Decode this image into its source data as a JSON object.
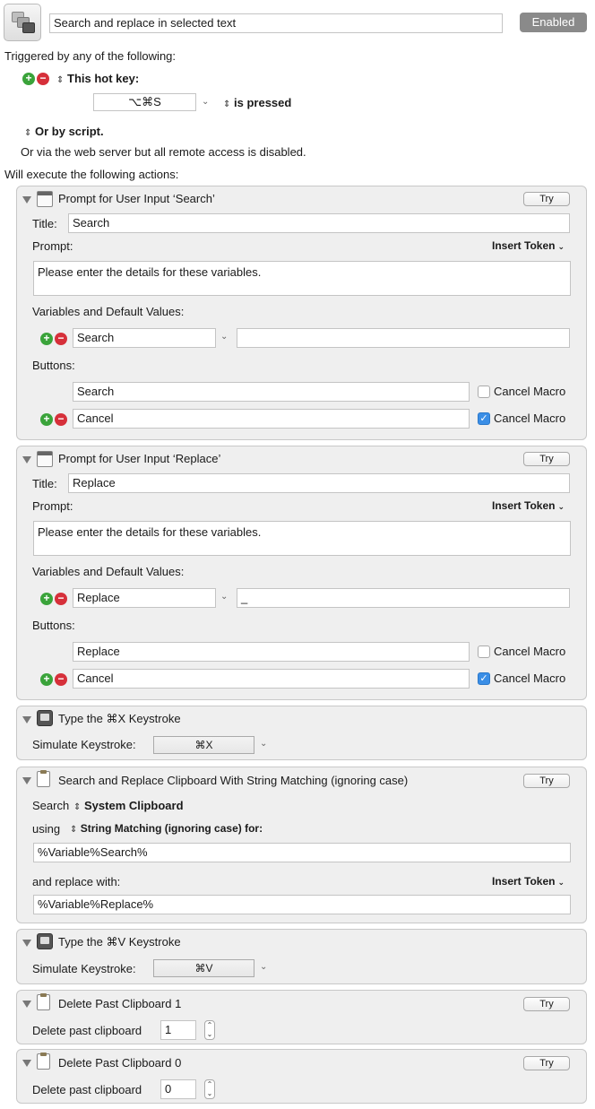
{
  "header": {
    "macro_name": "Search and replace in selected text",
    "enabled_label": "Enabled",
    "triggered_label": "Triggered by any of the following:",
    "hotkey_label": "This hot key:",
    "hotkey_value": "⌥⌘S",
    "is_pressed_label": "is pressed",
    "or_by_script_label": "Or by script.",
    "web_server_text": "Or via the web server but all remote access is disabled.",
    "will_execute_label": "Will execute the following actions:"
  },
  "actions": {
    "prompt_search": {
      "title": "Prompt for User Input ‘Search’",
      "try": "Try",
      "title_label": "Title:",
      "title_value": "Search",
      "prompt_label": "Prompt:",
      "insert_token": "Insert Token",
      "prompt_text": "Please enter the details for these variables.",
      "variables_label": "Variables and Default Values:",
      "variable_name": "Search",
      "variable_default": "",
      "buttons_label": "Buttons:",
      "button1": "Search",
      "button2": "Cancel",
      "cancel_macro": "Cancel Macro"
    },
    "prompt_replace": {
      "title": "Prompt for User Input ‘Replace’",
      "try": "Try",
      "title_label": "Title:",
      "title_value": "Replace",
      "prompt_label": "Prompt:",
      "insert_token": "Insert Token",
      "prompt_text": "Please enter the details for these variables.",
      "variables_label": "Variables and Default Values:",
      "variable_name": "Replace",
      "variable_default": "_",
      "buttons_label": "Buttons:",
      "button1": "Replace",
      "button2": "Cancel",
      "cancel_macro": "Cancel Macro"
    },
    "type_cut": {
      "title": "Type the ⌘X Keystroke",
      "simulate_label": "Simulate Keystroke:",
      "keystroke": "⌘X"
    },
    "search_replace": {
      "title": "Search and Replace Clipboard With String Matching (ignoring case)",
      "try": "Try",
      "search_label": "Search",
      "clipboard": "System Clipboard",
      "using_label": "using",
      "matching": "String Matching (ignoring case) for:",
      "search_for": "%Variable%Search%",
      "replace_label": "and replace with:",
      "insert_token": "Insert Token",
      "replace_with": "%Variable%Replace%"
    },
    "type_paste": {
      "title": "Type the ⌘V Keystroke",
      "simulate_label": "Simulate Keystroke:",
      "keystroke": "⌘V"
    },
    "delete_1": {
      "title": "Delete Past Clipboard 1",
      "try": "Try",
      "label": "Delete past clipboard",
      "value": "1"
    },
    "delete_0": {
      "title": "Delete Past Clipboard 0",
      "try": "Try",
      "label": "Delete past clipboard",
      "value": "0"
    }
  },
  "colors": {
    "add": "#3aa33a",
    "remove": "#d6303a",
    "check": "#3a8ee6",
    "enabled_button": "#8a8a8a"
  }
}
